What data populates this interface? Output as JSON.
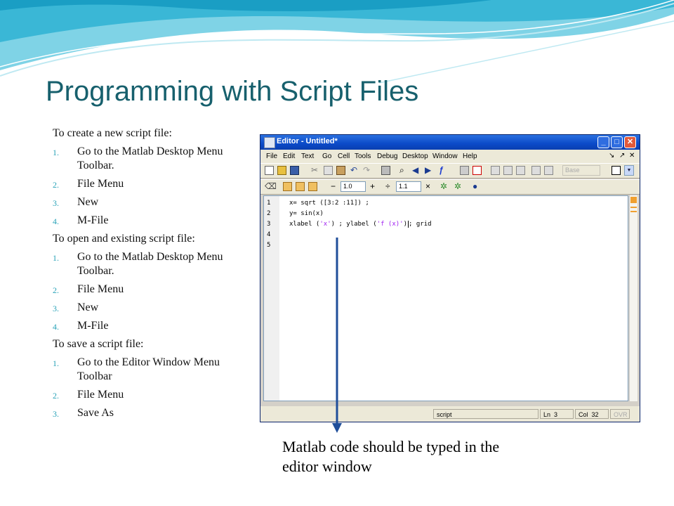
{
  "slide": {
    "title": "Programming with Script Files",
    "caption": "Matlab code should be typed in the editor window",
    "colors": {
      "title": "#17606d",
      "list_number": "#2aa3b8",
      "arrow": "#1f4e9a"
    }
  },
  "sections": [
    {
      "header": "To create a new script file:",
      "items": [
        {
          "num": "1.",
          "text": "Go to the Matlab Desktop Menu Toolbar."
        },
        {
          "num": "2.",
          "text": "File Menu"
        },
        {
          "num": "3.",
          "text": "New"
        },
        {
          "num": "4.",
          "text": "M-File"
        }
      ]
    },
    {
      "header": "To open and existing script file:",
      "items": [
        {
          "num": "1.",
          "text": "Go to the Matlab Desktop Menu Toolbar."
        },
        {
          "num": "2.",
          "text": "File Menu"
        },
        {
          "num": "3.",
          "text": "New"
        },
        {
          "num": "4.",
          "text": "M-File"
        }
      ]
    },
    {
      "header": "To save a script file:",
      "items": [
        {
          "num": "1.",
          "text": "Go to the Editor Window Menu Toolbar"
        },
        {
          "num": "2.",
          "text": "File Menu"
        },
        {
          "num": "3.",
          "text": "Save As"
        }
      ]
    }
  ],
  "editor": {
    "window_title": "Editor - Untitled*",
    "menus": [
      "File",
      "Edit",
      "Text",
      "Go",
      "Cell",
      "Tools",
      "Debug",
      "Desktop",
      "Window",
      "Help"
    ],
    "stack_value": "Base",
    "cell_step_1": "1.0",
    "cell_step_2": "1.1",
    "line_numbers": [
      "1",
      "2",
      "3",
      "4",
      "5"
    ],
    "code": {
      "l1": "x= sqrt ([3:2 :11]) ;",
      "l2": "y= sin(x)",
      "l3_a": "xlabel (",
      "l3_s1": "'x'",
      "l3_b": ") ; ylabel (",
      "l3_s2": "'f (x)'",
      "l3_c": ")",
      "l3_d": "; grid"
    },
    "status": {
      "mode": "script",
      "ln_label": "Ln",
      "ln": "3",
      "col_label": "Col",
      "col": "32",
      "ovr": "OVR"
    },
    "icons": [
      "new-file-icon",
      "open-folder-icon",
      "save-icon",
      "cut-icon",
      "copy-icon",
      "paste-icon",
      "undo-icon",
      "redo-icon",
      "print-icon",
      "find-icon",
      "back-arrow-icon",
      "forward-arrow-icon",
      "function-icon",
      "stack-icon",
      "stop-icon",
      "run-icon",
      "help-icon"
    ]
  }
}
